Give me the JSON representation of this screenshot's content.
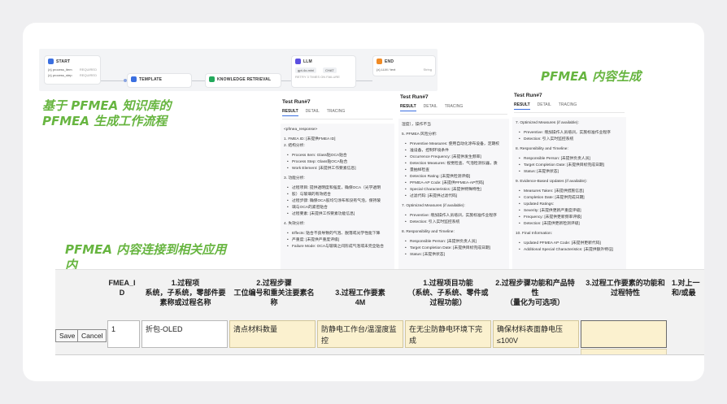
{
  "workflow": {
    "start": {
      "label": "START",
      "rows": [
        [
          "{x} process_item",
          "REQUIRED"
        ],
        [
          "{x} process_step",
          "REQUIRED"
        ]
      ]
    },
    "template": {
      "label": "TEMPLATE"
    },
    "knowledge": {
      "label": "KNOWLEDGE RETRIEVAL"
    },
    "llm": {
      "label": "LLM",
      "model": "gpt-4o-mini",
      "tag": "CHAT",
      "note": "RETRY 3 TIMES ON FAILURE"
    },
    "end": {
      "label": "END",
      "rows": [
        [
          "{x} LLM / text",
          "String"
        ]
      ]
    }
  },
  "titles": {
    "kb_flow": "基于 PFMEA 知识库的 PFMEA 生成工作流程",
    "generate": "PFMEA 内容生成",
    "connect": "PFMEA 内容连接到相关应用内"
  },
  "panels": [
    {
      "title": "Test Run#7",
      "tabs": [
        "RESULT",
        "DETAIL",
        "TRACING"
      ],
      "lines": [
        [
          "t",
          "<pfmea_response>"
        ],
        [
          "g",
          ""
        ],
        [
          "t",
          "1. FMEA ID: [未提供FMEA ID]"
        ],
        [
          "t",
          "2. 结构分析:"
        ],
        [
          "g",
          ""
        ],
        [
          "b",
          "Process Item: Glass贴OCA贴合"
        ],
        [
          "b",
          "Process Step: Glass贴OCA贴合"
        ],
        [
          "b",
          "Work Element: [未提供工作要素信息]"
        ],
        [
          "g",
          ""
        ],
        [
          "t",
          "3. 功能分析:"
        ],
        [
          "g",
          ""
        ],
        [
          "b",
          "过程项目: 提供透明度和强度，确保OCA（光学透明"
        ],
        [
          "b",
          "胶）与玻璃的有效结合"
        ],
        [
          "b",
          "过程步骤: 确保OCA胶均匀涂布和没有气泡，保持玻"
        ],
        [
          "b",
          "璃与OCA的紧密贴合"
        ],
        [
          "b",
          "过程要素: [未提供工作要素功能信息]"
        ],
        [
          "g",
          ""
        ],
        [
          "t",
          "4. 失效分析:"
        ],
        [
          "g",
          ""
        ],
        [
          "b",
          "Effects: 贴合不良导致的气泡、脱落或光学性能下降"
        ],
        [
          "b",
          "严重度: [未提供严重度评级]"
        ],
        [
          "b",
          "Failure Mode: OCA与玻璃之间形成气泡或未完全贴合"
        ]
      ]
    },
    {
      "title": "Test Run#7",
      "tabs": [
        "RESULT",
        "DETAIL",
        "TRACING"
      ],
      "lines": [
        [
          "t",
          "湿度），操作不当"
        ],
        [
          "g",
          ""
        ],
        [
          "t",
          "5. PFMEA 风险分析:"
        ],
        [
          "g",
          ""
        ],
        [
          "b",
          "Preventive Measures: 使用自动化涂布设备，定期校"
        ],
        [
          "b",
          "准设备，控制环境条件"
        ],
        [
          "b",
          "Occurrence Frequency: [未提供发生频率]"
        ],
        [
          "b",
          "Detection Measures: 视觉检查、气泡检测仪器，质"
        ],
        [
          "b",
          "量抽样检查"
        ],
        [
          "b",
          "Detection Rating: [未提供检测评级]"
        ],
        [
          "b",
          "PFMEA-AP Code: [未提供PFMEA-AP代码]"
        ],
        [
          "b",
          "Special Characteristics: [未提供特殊特性]"
        ],
        [
          "b",
          "过滤代码: [未提供过滤代码]"
        ],
        [
          "g",
          ""
        ],
        [
          "t",
          "7. Optimized Measures (if available):"
        ],
        [
          "g",
          ""
        ],
        [
          "b",
          "Preventive: 增加操作人员培训，实施标准作业程序"
        ],
        [
          "b",
          "Detection: 引入实时监控系统"
        ],
        [
          "g",
          ""
        ],
        [
          "t",
          "8. Responsibility and Timeline:"
        ],
        [
          "g",
          ""
        ],
        [
          "b",
          "Responsible Person: [未提供负责人员]"
        ],
        [
          "b",
          "Target Completion Date: [未提供目标完成日期]"
        ],
        [
          "b",
          "Status: [未提供状态]"
        ]
      ]
    },
    {
      "title": "Test Run#7",
      "tabs": [
        "RESULT",
        "DETAIL",
        "TRACING"
      ],
      "lines": [
        [
          "t",
          "7. Optimized Measures (if available):"
        ],
        [
          "g",
          ""
        ],
        [
          "b",
          "Preventive: 增加操作人员培训，实施标准作业程序"
        ],
        [
          "b",
          "Detection: 引入实时监控系统"
        ],
        [
          "g",
          ""
        ],
        [
          "t",
          "8. Responsibility and Timeline:"
        ],
        [
          "g",
          ""
        ],
        [
          "b",
          "Responsible Person: [未提供负责人员]"
        ],
        [
          "b",
          "Target Completion Date: [未提供目标完成日期]"
        ],
        [
          "b",
          "Status: [未提供状态]"
        ],
        [
          "g",
          ""
        ],
        [
          "t",
          "9. Evidence-Based Updates (if available):"
        ],
        [
          "g",
          ""
        ],
        [
          "b",
          "Measures Taken: [未提供措施信息]"
        ],
        [
          "b",
          "Completion Date: [未提供完成日期]"
        ],
        [
          "b",
          "Updated Ratings:"
        ],
        [
          "b",
          "Severity: [未提供更新严重度评级]"
        ],
        [
          "b",
          "Frequency: [未提供更新频率评级]"
        ],
        [
          "b",
          "Detection: [未提供更新检测评级]"
        ],
        [
          "g",
          ""
        ],
        [
          "t",
          "10. Final Information:"
        ],
        [
          "g",
          ""
        ],
        [
          "b",
          "Updated PFMEA AP Code: [未提供更新代码]"
        ],
        [
          "b",
          "Additional Special Characteristics: [未提供额外特征]"
        ]
      ]
    }
  ],
  "form": {
    "headers": [
      "FMEA_I\nD",
      "1.过程项\n系统，子系统，零部件要\n素称或过程名称",
      "2.过程步骤\n工位编号和重关注要素名\n称",
      "3.过程工作要素\n4M",
      "1.过程项目功能\n（系统、子系统、零件或\n过程功能）",
      "2.过程步骤功能和产品特\n性\n（量化为可选项）",
      "3.过程工作要素的功能和\n过程特性",
      "1.对上一\n和/或最"
    ],
    "save_label": "Save",
    "cancel_label": "Cancel",
    "values": {
      "fmea_id": "1",
      "process_item": "折包-OLED",
      "process_step": "清点材料数量",
      "work_element": "防静电工作台/温湿度监控\n仪/无尘环境",
      "item_function": "在无尘防静电环境下完成\nOLED材料数量清点",
      "step_function": "确保材料表面静电压\n≤100V",
      "element_function": ""
    }
  }
}
